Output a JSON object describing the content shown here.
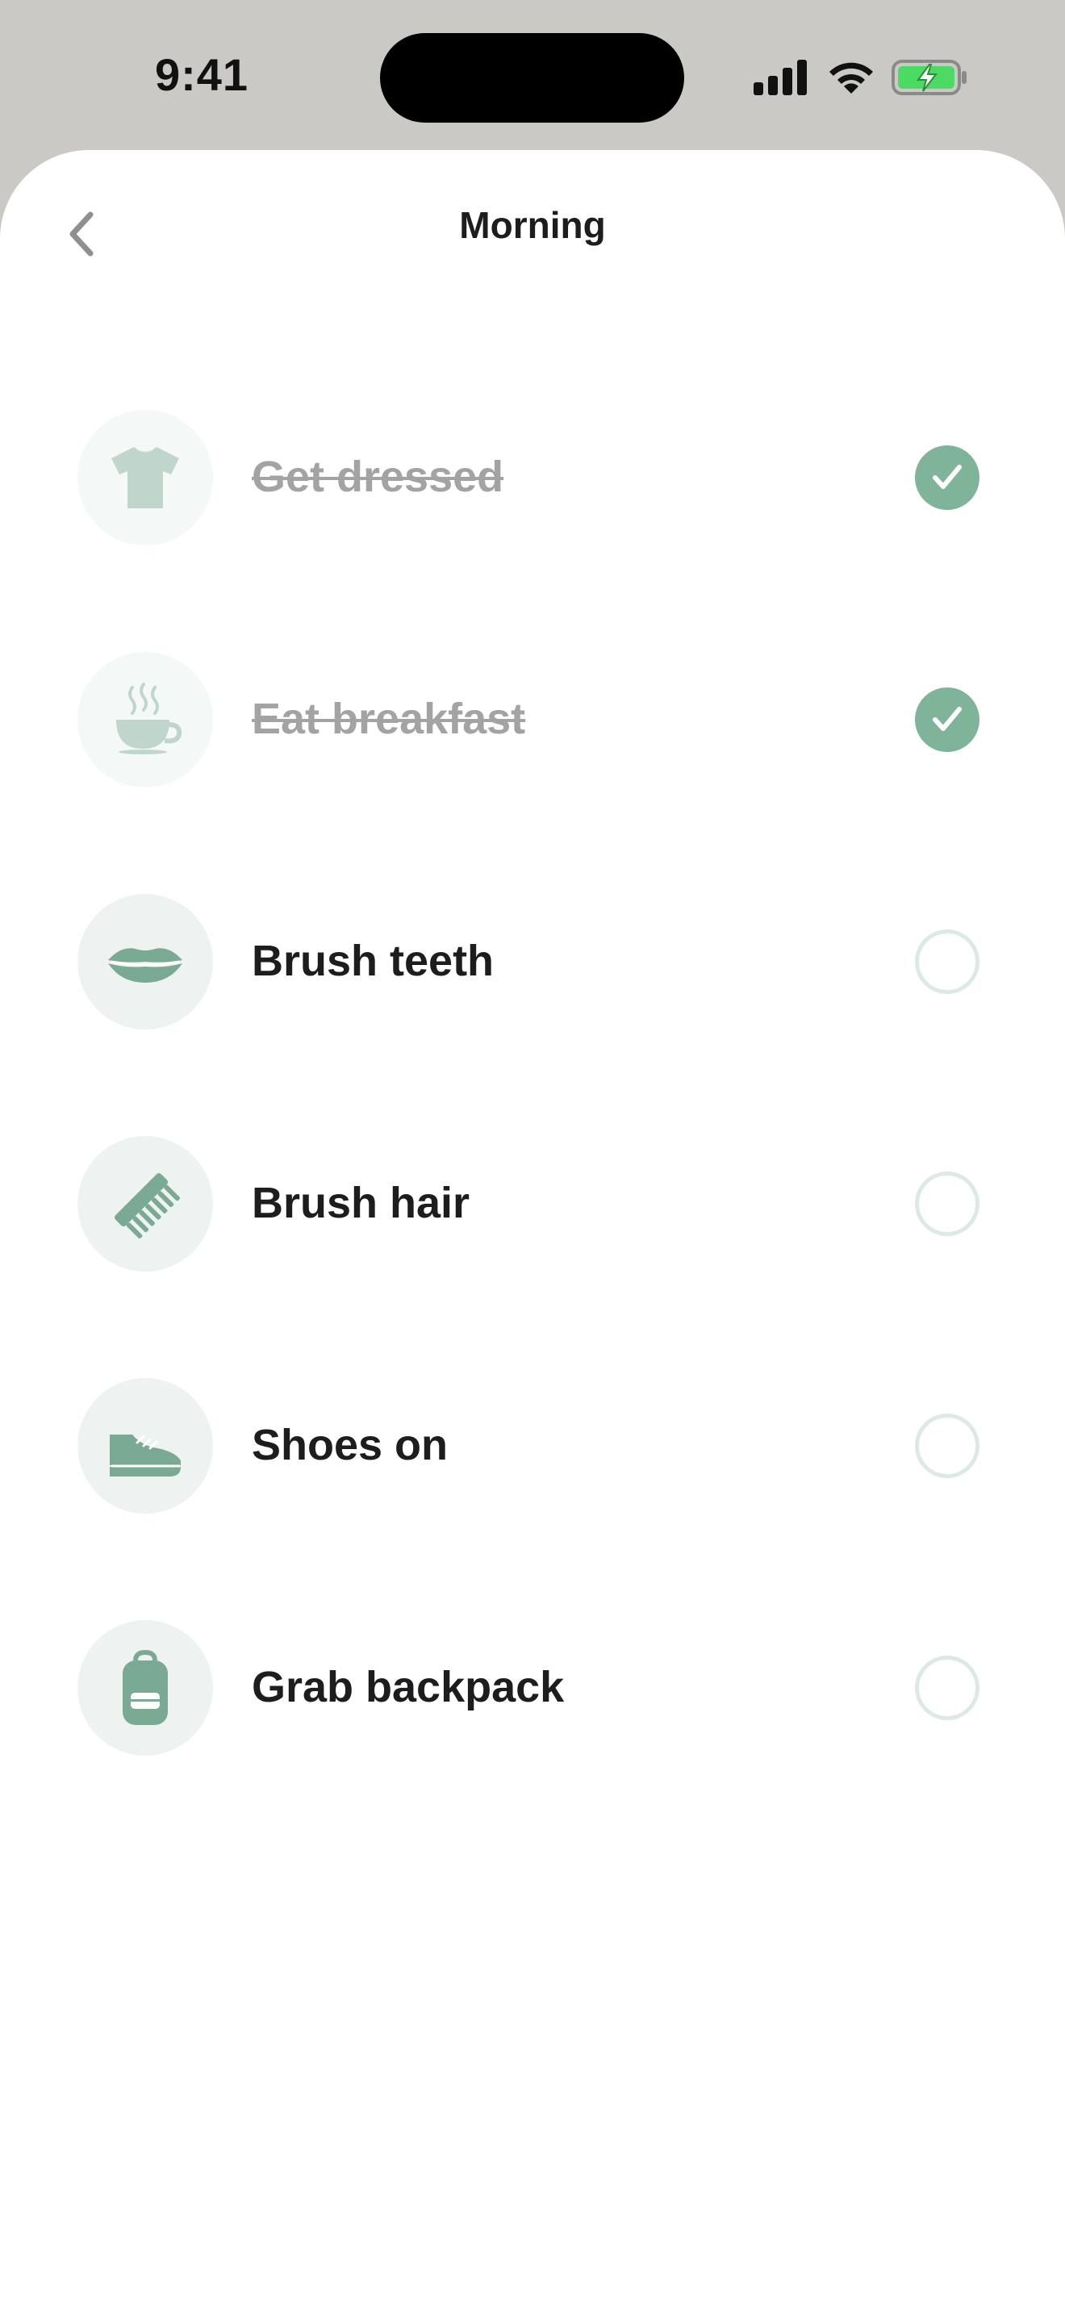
{
  "status_bar": {
    "time": "9:41",
    "icons": [
      "cellular-signal-icon",
      "wifi-icon",
      "battery-charging-icon"
    ]
  },
  "nav": {
    "title": "Morning",
    "back_icon": "chevron-left-icon"
  },
  "colors": {
    "accent": "#7fb39a",
    "icon_fill": "#7aa994",
    "icon_background": "#eef3f1",
    "unchecked_ring": "#dde9e4",
    "done_text": "#a3a3a3",
    "text": "#1d1d1f"
  },
  "tasks": [
    {
      "label": "Get dressed",
      "icon": "tshirt-icon",
      "done": true
    },
    {
      "label": "Eat breakfast",
      "icon": "coffee-cup-icon",
      "done": true
    },
    {
      "label": "Brush teeth",
      "icon": "lips-icon",
      "done": false
    },
    {
      "label": "Brush hair",
      "icon": "comb-icon",
      "done": false
    },
    {
      "label": "Shoes on",
      "icon": "sneaker-icon",
      "done": false
    },
    {
      "label": "Grab backpack",
      "icon": "backpack-icon",
      "done": false
    }
  ]
}
